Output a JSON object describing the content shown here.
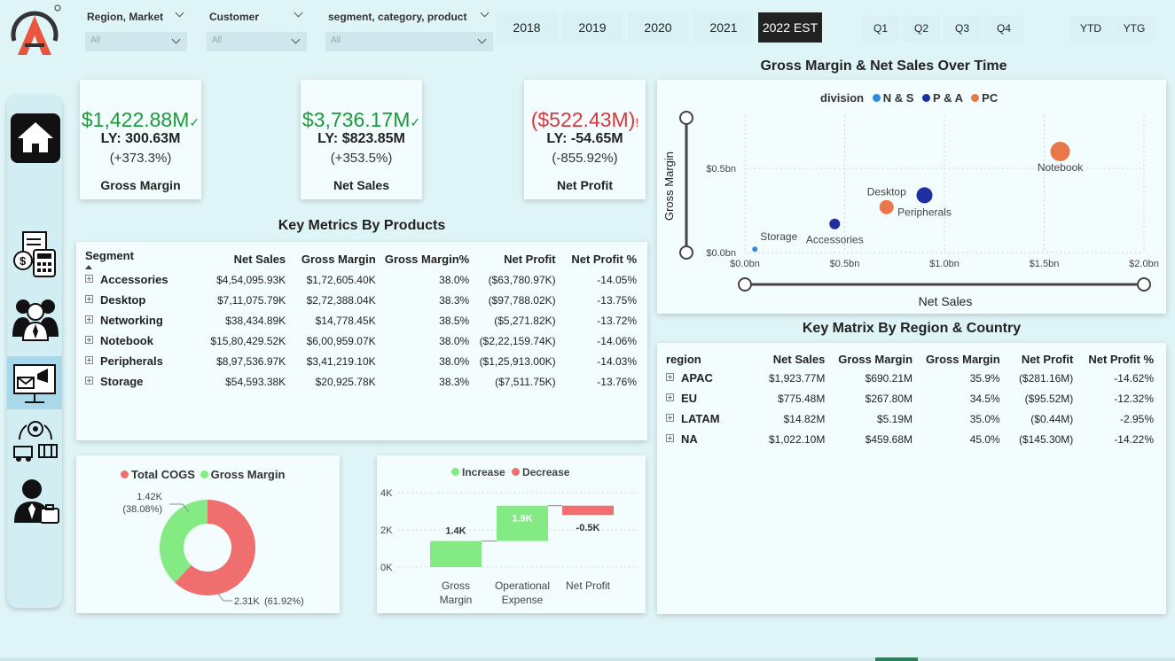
{
  "slicers": [
    {
      "label": "Region, Market",
      "value": "All"
    },
    {
      "label": "Customer",
      "value": "All"
    },
    {
      "label": "segment, category, product",
      "value": "All"
    }
  ],
  "years": [
    "2018",
    "2019",
    "2020",
    "2021",
    "2022 EST"
  ],
  "selected_year": "2022 EST",
  "quarters": [
    "Q1",
    "Q2",
    "Q3",
    "Q4"
  ],
  "periods": [
    "YTD",
    "YTG"
  ],
  "kpis": [
    {
      "value": "$1,422.88M",
      "flag": "✓",
      "ly": "LY: 300.63M",
      "pct": "(+373.3%)",
      "title": "Gross Margin",
      "color": "#1a9a3c"
    },
    {
      "value": "$3,736.17M",
      "flag": "✓",
      "ly": "LY: $823.85M",
      "pct": "(+353.5%)",
      "title": "Net Sales",
      "color": "#1a9a3c"
    },
    {
      "value": "($522.43M)",
      "flag": "!",
      "ly": "LY: -54.65M",
      "pct": "(-855.92%)",
      "title": "Net Profit",
      "color": "#d9363e"
    }
  ],
  "product_table": {
    "title": "Key Metrics By Products",
    "columns": [
      "Segment",
      "Net Sales",
      "Gross Margin",
      "Gross Margin%",
      "Net Profit",
      "Net Profit %"
    ],
    "rows": [
      [
        "Accessories",
        "$4,54,095.93K",
        "$1,72,605.40K",
        "38.0%",
        "($63,780.97K)",
        "-14.05%"
      ],
      [
        "Desktop",
        "$7,11,075.79K",
        "$2,72,388.04K",
        "38.3%",
        "($97,788.02K)",
        "-13.75%"
      ],
      [
        "Networking",
        "$38,434.89K",
        "$14,778.45K",
        "38.5%",
        "($5,271.82K)",
        "-13.72%"
      ],
      [
        "Notebook",
        "$15,80,429.52K",
        "$6,00,959.07K",
        "38.0%",
        "($2,22,159.74K)",
        "-14.06%"
      ],
      [
        "Peripherals",
        "$8,97,536.97K",
        "$3,41,219.10K",
        "38.0%",
        "($1,25,913.00K)",
        "-14.03%"
      ],
      [
        "Storage",
        "$54,593.38K",
        "$20,925.78K",
        "38.3%",
        "($7,511.75K)",
        "-13.76%"
      ]
    ]
  },
  "region_table": {
    "title": "Key Matrix By Region & Country",
    "columns": [
      "region",
      "Net Sales",
      "Gross Margin",
      "Gross Margin",
      "Net Profit",
      "Net Profit %"
    ],
    "rows": [
      [
        "APAC",
        "$1,923.77M",
        "$690.21M",
        "35.9%",
        "($281.16M)",
        "-14.62%"
      ],
      [
        "EU",
        "$775.48M",
        "$267.80M",
        "34.5%",
        "($95.52M)",
        "-12.32%"
      ],
      [
        "LATAM",
        "$14.82M",
        "$5.19M",
        "35.0%",
        "($0.44M)",
        "-2.95%"
      ],
      [
        "NA",
        "$1,022.10M",
        "$459.68M",
        "45.0%",
        "($145.30M)",
        "-14.22%"
      ]
    ]
  },
  "chart_data": [
    {
      "type": "scatter",
      "title": "Gross Margin & Net Sales  Over Time",
      "xlabel": "Net Sales",
      "ylabel": "Gross Margin",
      "legend_title": "division",
      "legend_position": "top",
      "xlim": [
        0,
        2.0
      ],
      "ylim": [
        0,
        0.5
      ],
      "x_ticks": [
        "$0.0bn",
        "$0.5bn",
        "$1.0bn",
        "$1.5bn",
        "$2.0bn"
      ],
      "y_ticks": [
        "$0.0bn",
        "$0.5bn"
      ],
      "grid": true,
      "series": [
        {
          "name": "N & S",
          "color": "#2b8be0",
          "points": [
            {
              "label": "Storage",
              "x": 0.05,
              "y": 0.02,
              "size": 3
            }
          ]
        },
        {
          "name": "P & A",
          "color": "#1f2ea0",
          "points": [
            {
              "label": "Accessories",
              "x": 0.45,
              "y": 0.17,
              "size": 6
            },
            {
              "label": "Peripherals",
              "x": 0.9,
              "y": 0.34,
              "size": 9
            }
          ]
        },
        {
          "name": "PC",
          "color": "#e8784a",
          "points": [
            {
              "label": "Desktop",
              "x": 0.71,
              "y": 0.27,
              "size": 8
            },
            {
              "label": "Notebook",
              "x": 1.58,
              "y": 0.6,
              "size": 11
            }
          ]
        }
      ]
    },
    {
      "type": "pie",
      "legend": [
        "Total COGS",
        "Gross Margin"
      ],
      "colors": [
        "#ef6f6f",
        "#84eb84"
      ],
      "slices": [
        {
          "name": "Gross Margin",
          "value": 1.42,
          "label": "1.42K",
          "pct": "(38.08%)"
        },
        {
          "name": "Total COGS",
          "value": 2.31,
          "label": "2.31K",
          "pct": "(61.92%)"
        }
      ]
    },
    {
      "type": "bar",
      "subtype": "waterfall",
      "legend": [
        "Increase",
        "Decrease"
      ],
      "colors": {
        "increase": "#84eb84",
        "decrease": "#ef6f6f"
      },
      "categories": [
        "Gross Margin",
        "Operational Expense",
        "Net Profit"
      ],
      "steps": [
        {
          "start": 0,
          "end": 1.4,
          "label": "1.4K"
        },
        {
          "start": 1.4,
          "end": 3.3,
          "label": "1.9K"
        },
        {
          "start": 3.3,
          "end": 2.8,
          "label": "-0.5K"
        }
      ],
      "y_ticks": [
        "0K",
        "2K",
        "4K"
      ],
      "ylim": [
        0,
        4
      ]
    }
  ]
}
